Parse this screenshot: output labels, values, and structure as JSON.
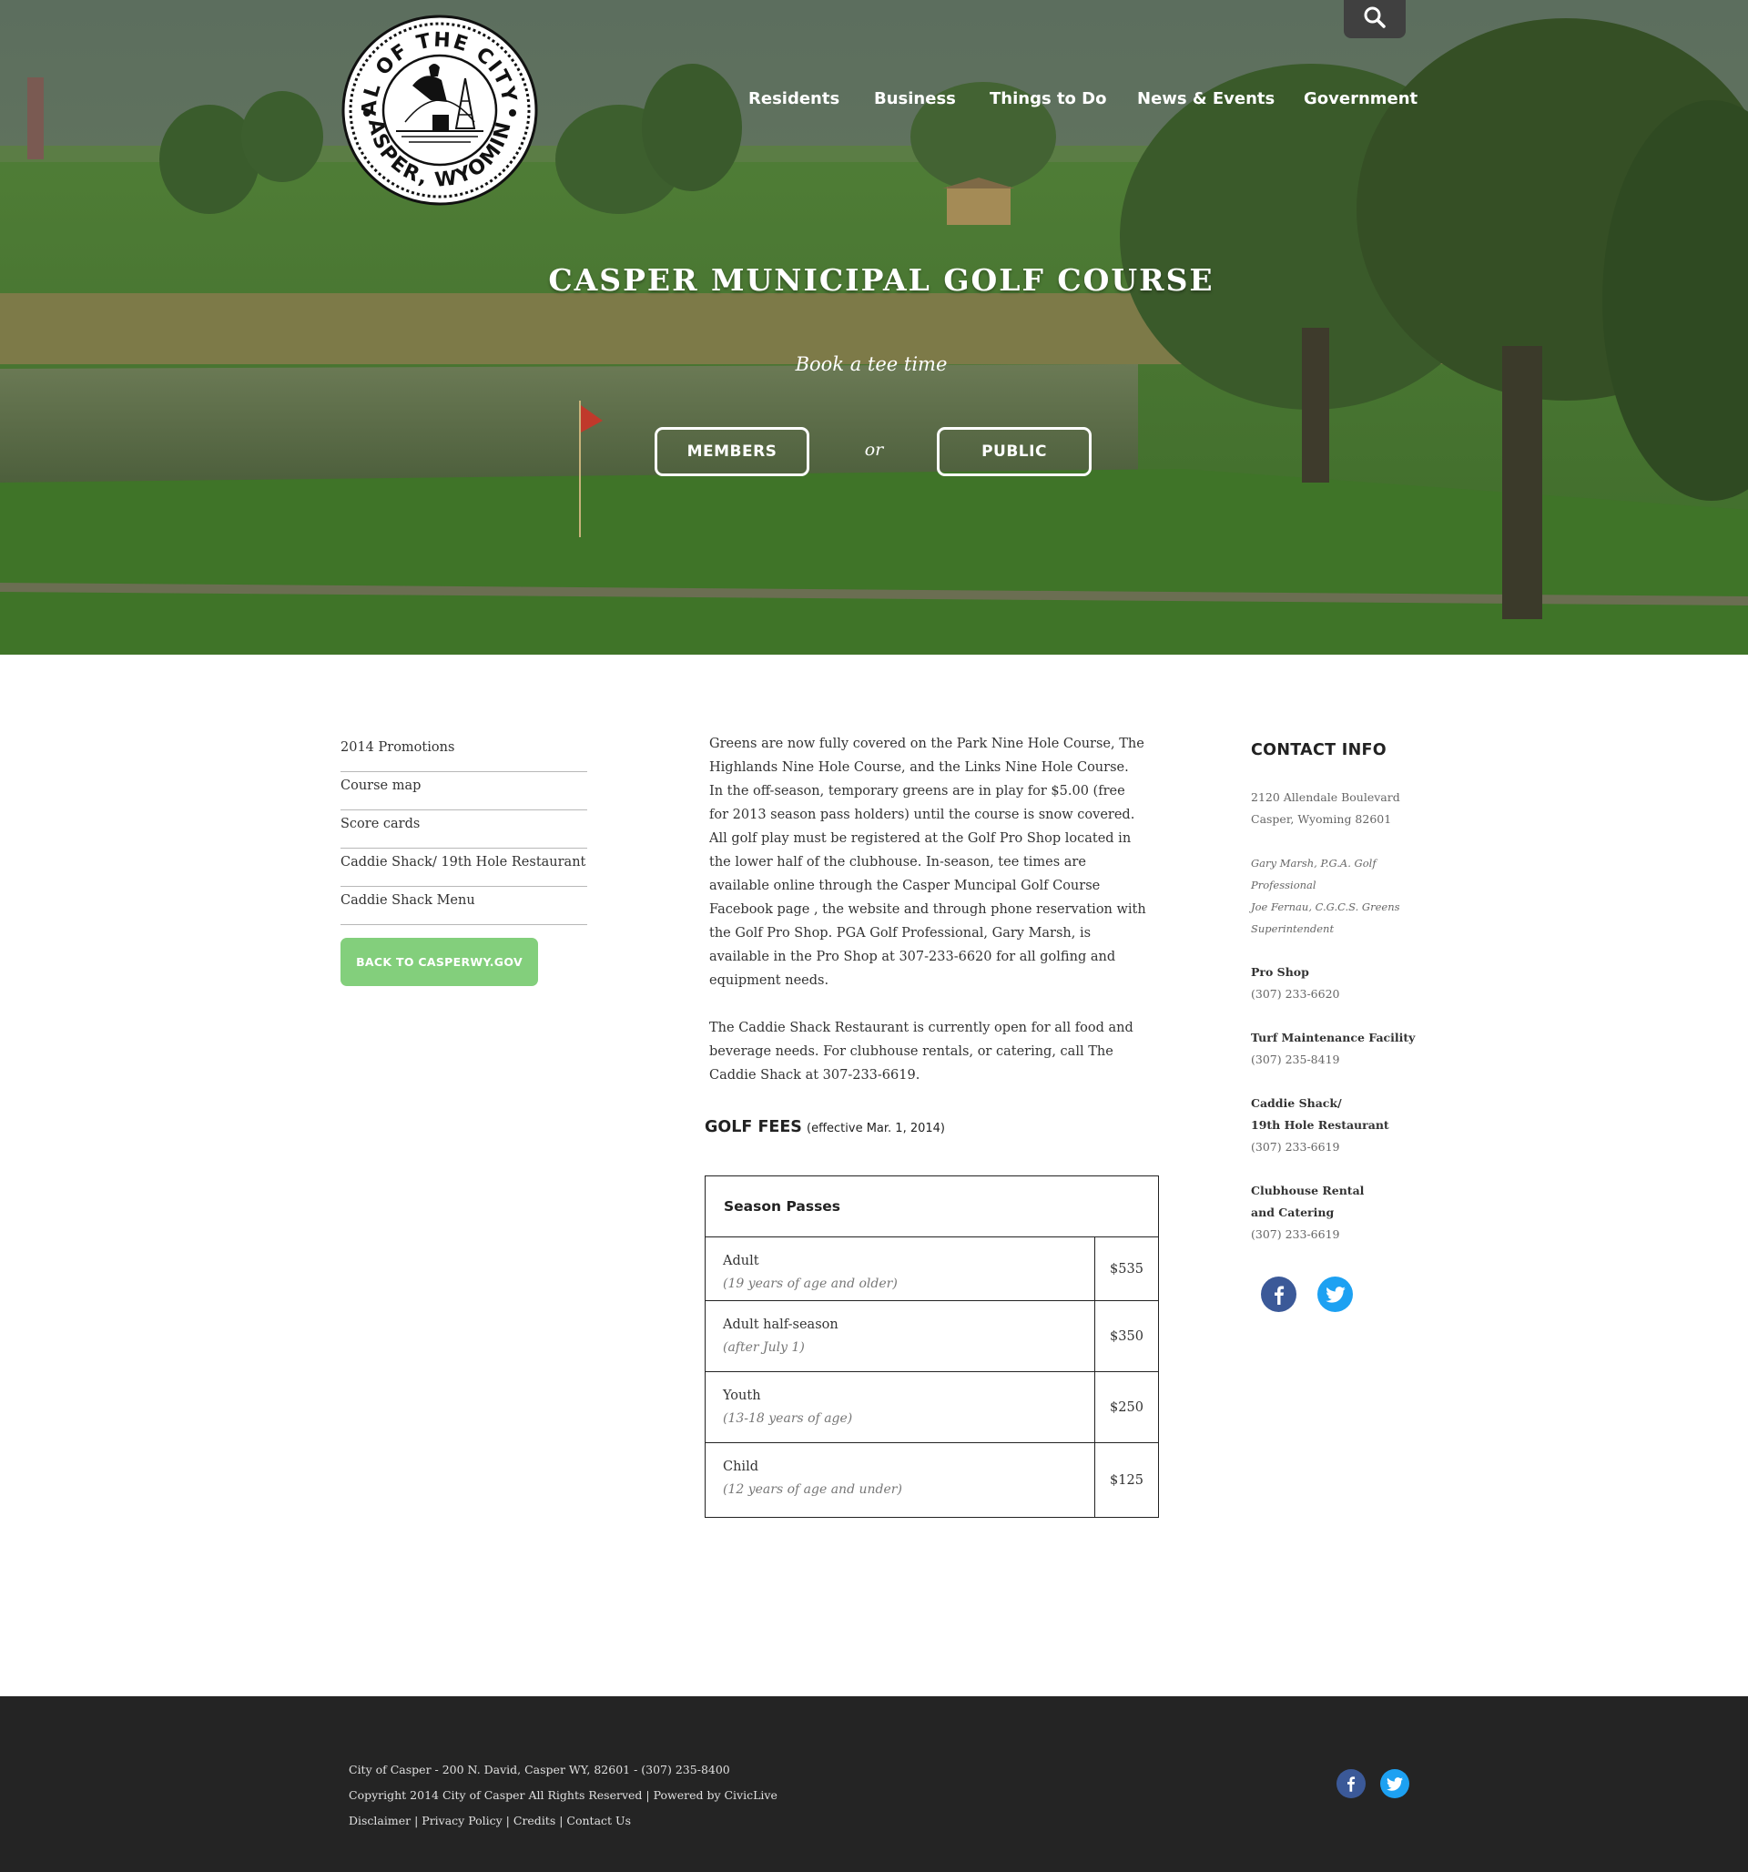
{
  "header": {
    "seal": {
      "ring_text_top": "SEAL OF THE CITY OF",
      "ring_text_bottom": "CASPER, WYOMING"
    },
    "search_icon": "search-icon",
    "nav": [
      {
        "label": "Residents"
      },
      {
        "label": "Business"
      },
      {
        "label": "Things to Do"
      },
      {
        "label": "News & Events"
      },
      {
        "label": "Government"
      }
    ]
  },
  "hero": {
    "title": "CASPER MUNICIPAL GOLF COURSE",
    "subtitle": "Book a tee time",
    "members_label": "MEMBERS",
    "or_label": "or",
    "public_label": "PUBLIC"
  },
  "sidebar": {
    "links": [
      {
        "label": "2014 Promotions"
      },
      {
        "label": "Course map"
      },
      {
        "label": "Score cards"
      },
      {
        "label": "Caddie Shack/ 19th Hole Restaurant"
      },
      {
        "label": "Caddie Shack Menu"
      }
    ],
    "back_button": "BACK TO CASPERWY.GOV",
    "back_button_color": "#83cf7c"
  },
  "content": {
    "paragraph_1": "Greens are now fully covered on the Park Nine Hole Course, The Highlands Nine Hole Course, and the Links Nine Hole Course. In the off-season, temporary greens are in play for $5.00 (free for 2013 season pass holders) until the course is snow covered. All golf play must be registered at the Golf Pro Shop located in the lower half of the clubhouse. In-season, tee times are available online through the Casper Muncipal Golf Course Facebook page , the website and through phone reservation with the Golf Pro Shop. PGA Golf Professional, Gary Marsh, is available in the Pro Shop at 307-233-6620 for all golfing and equipment needs.",
    "paragraph_2": "The Caddie Shack Restaurant is currently open for all food and beverage needs. For clubhouse rentals, or catering, call The Caddie Shack at 307-233-6619."
  },
  "fees": {
    "heading": "GOLF FEES",
    "effective": "(effective Mar. 1, 2014)",
    "table_title": "Season Passes",
    "rows": [
      {
        "name": "Adult",
        "note": "(19 years of age and older)",
        "price": "$535"
      },
      {
        "name": "Adult half-season",
        "note": "(after July 1)",
        "price": "$350"
      },
      {
        "name": "Youth",
        "note": "(13-18 years of age)",
        "price": "$250"
      },
      {
        "name": "Child",
        "note": "(12 years of age and under)",
        "price": "$125"
      }
    ]
  },
  "contact": {
    "title": "CONTACT INFO",
    "address_1": "2120 Allendale Boulevard",
    "address_2": "Casper, Wyoming 82601",
    "staff_1a": "Gary Marsh, P.G.A. Golf",
    "staff_1b": "Professional",
    "staff_2a": "Joe Fernau, C.G.C.S. Greens",
    "staff_2b": "Superintendent",
    "pro_shop_label": "Pro Shop",
    "pro_shop_phone": "(307) 233-6620",
    "turf_label": "Turf Maintenance Facility",
    "turf_phone": "(307) 235-8419",
    "caddie_label_1": "Caddie Shack/",
    "caddie_label_2": "19th Hole Restaurant",
    "caddie_phone": "(307) 233-6619",
    "clubhouse_label_1": "Clubhouse Rental",
    "clubhouse_label_2": "and Catering",
    "clubhouse_phone": "(307) 233-6619"
  },
  "social": {
    "facebook_icon": "facebook-icon",
    "twitter_icon": "twitter-icon",
    "facebook_color": "#3b5998",
    "twitter_color": "#1da1f2"
  },
  "footer": {
    "address_line": "City of Casper - 200 N. David, Casper WY, 82601 - (307) 235-8400",
    "copyright_line": "Copyright 2014 City of Casper All Rights Reserved | Powered by CivicLive",
    "links": [
      {
        "label": "Disclaimer"
      },
      {
        "label": "Privacy Policy"
      },
      {
        "label": "Credits"
      },
      {
        "label": "Contact Us"
      }
    ],
    "separator": " | ",
    "background": "#242424"
  }
}
